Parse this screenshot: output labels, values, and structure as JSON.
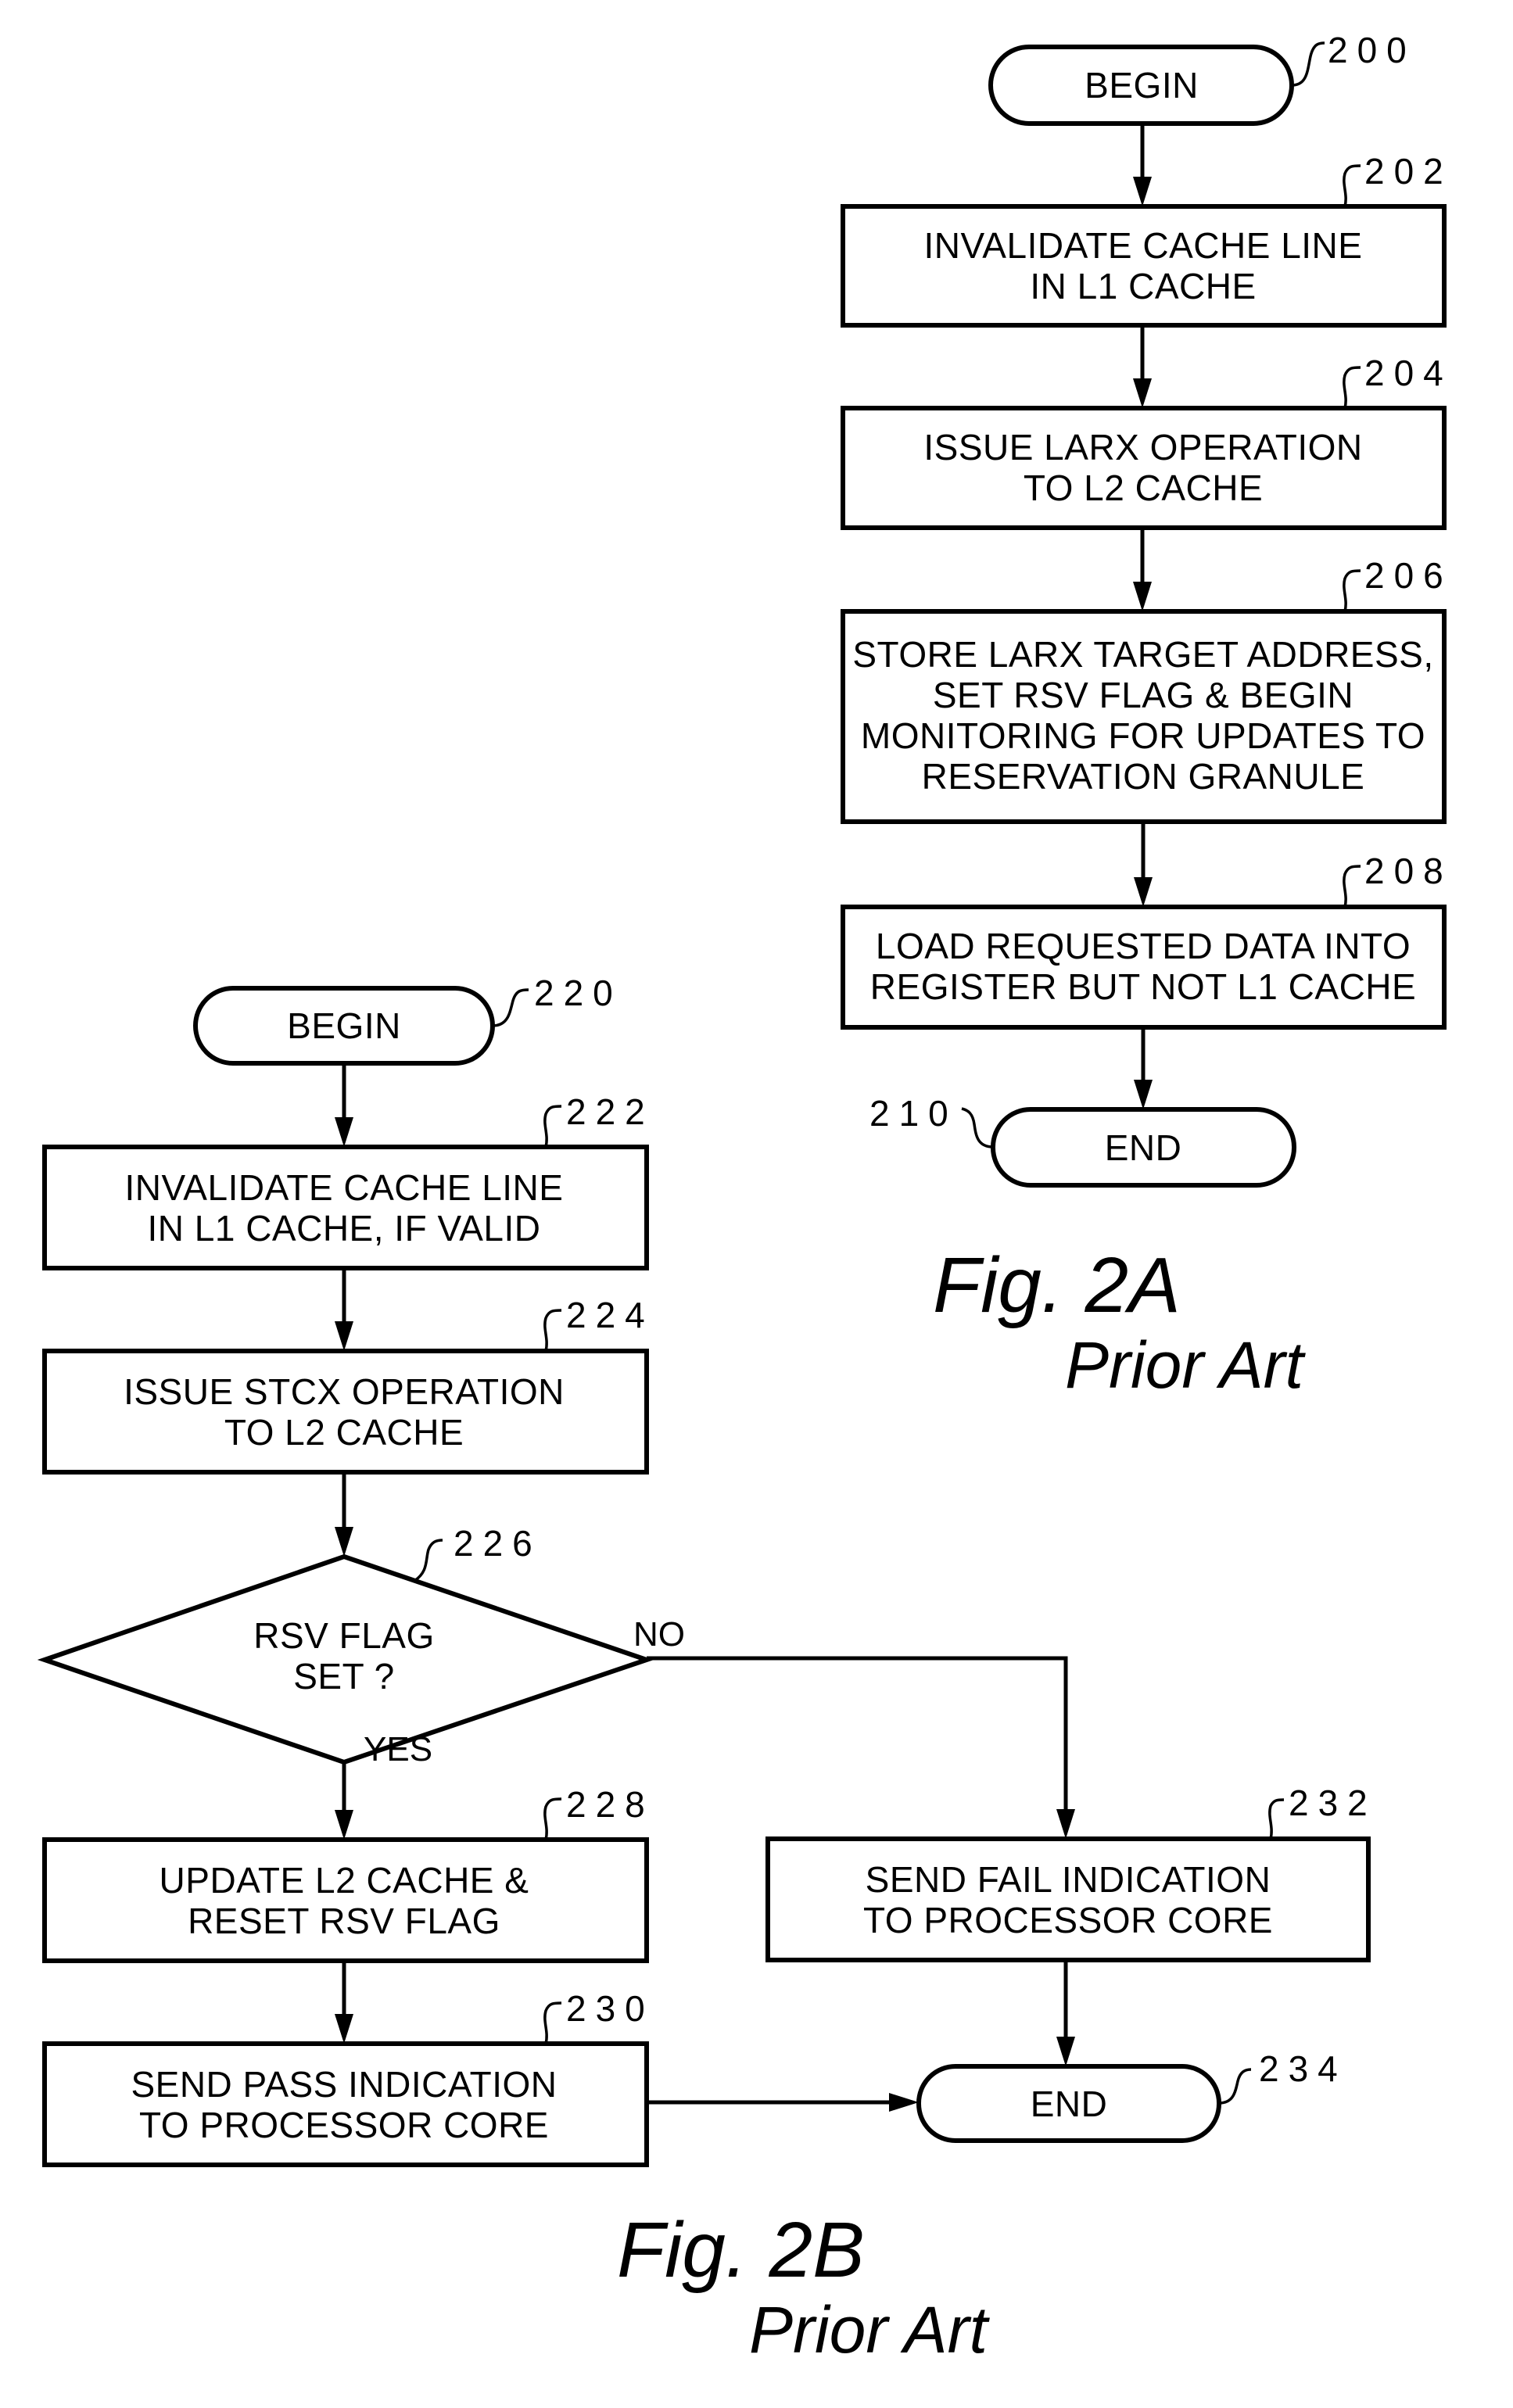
{
  "figures": {
    "fig2a": {
      "caption": "Fig.  2A",
      "subcaption": "Prior Art",
      "nodes": {
        "n200": {
          "ref": "200",
          "type": "terminator",
          "lines": [
            "BEGIN"
          ]
        },
        "n202": {
          "ref": "202",
          "type": "process",
          "lines": [
            "INVALIDATE CACHE LINE",
            "IN L1 CACHE"
          ]
        },
        "n204": {
          "ref": "204",
          "type": "process",
          "lines": [
            "ISSUE LARX OPERATION",
            "TO L2 CACHE"
          ]
        },
        "n206": {
          "ref": "206",
          "type": "process",
          "lines": [
            "STORE LARX TARGET ADDRESS,",
            "SET RSV FLAG & BEGIN",
            "MONITORING FOR UPDATES TO",
            "RESERVATION GRANULE"
          ]
        },
        "n208": {
          "ref": "208",
          "type": "process",
          "lines": [
            "LOAD REQUESTED DATA INTO",
            "REGISTER BUT NOT L1 CACHE"
          ]
        },
        "n210": {
          "ref": "210",
          "type": "terminator",
          "lines": [
            "END"
          ]
        }
      },
      "edges": [
        {
          "from": "200",
          "to": "202"
        },
        {
          "from": "202",
          "to": "204"
        },
        {
          "from": "204",
          "to": "206"
        },
        {
          "from": "206",
          "to": "208"
        },
        {
          "from": "208",
          "to": "210"
        }
      ]
    },
    "fig2b": {
      "caption": "Fig.  2B",
      "subcaption": "Prior Art",
      "nodes": {
        "n220": {
          "ref": "220",
          "type": "terminator",
          "lines": [
            "BEGIN"
          ]
        },
        "n222": {
          "ref": "222",
          "type": "process",
          "lines": [
            "INVALIDATE CACHE LINE",
            "IN L1 CACHE, IF VALID"
          ]
        },
        "n224": {
          "ref": "224",
          "type": "process",
          "lines": [
            "ISSUE STCX OPERATION",
            "TO L2 CACHE"
          ]
        },
        "n226": {
          "ref": "226",
          "type": "decision",
          "lines": [
            "RSV FLAG",
            "SET ?"
          ]
        },
        "n228": {
          "ref": "228",
          "type": "process",
          "lines": [
            "UPDATE L2 CACHE &",
            "RESET RSV FLAG"
          ]
        },
        "n230": {
          "ref": "230",
          "type": "process",
          "lines": [
            "SEND PASS INDICATION",
            "TO PROCESSOR CORE"
          ]
        },
        "n232": {
          "ref": "232",
          "type": "process",
          "lines": [
            "SEND FAIL INDICATION",
            "TO PROCESSOR CORE"
          ]
        },
        "n234": {
          "ref": "234",
          "type": "terminator",
          "lines": [
            "END"
          ]
        }
      },
      "branch_labels": {
        "yes": "YES",
        "no": "NO"
      },
      "edges": [
        {
          "from": "220",
          "to": "222"
        },
        {
          "from": "222",
          "to": "224"
        },
        {
          "from": "224",
          "to": "226"
        },
        {
          "from": "226",
          "to": "228",
          "label": "YES"
        },
        {
          "from": "226",
          "to": "232",
          "label": "NO"
        },
        {
          "from": "228",
          "to": "230"
        },
        {
          "from": "230",
          "to": "234"
        },
        {
          "from": "232",
          "to": "234"
        }
      ]
    }
  }
}
